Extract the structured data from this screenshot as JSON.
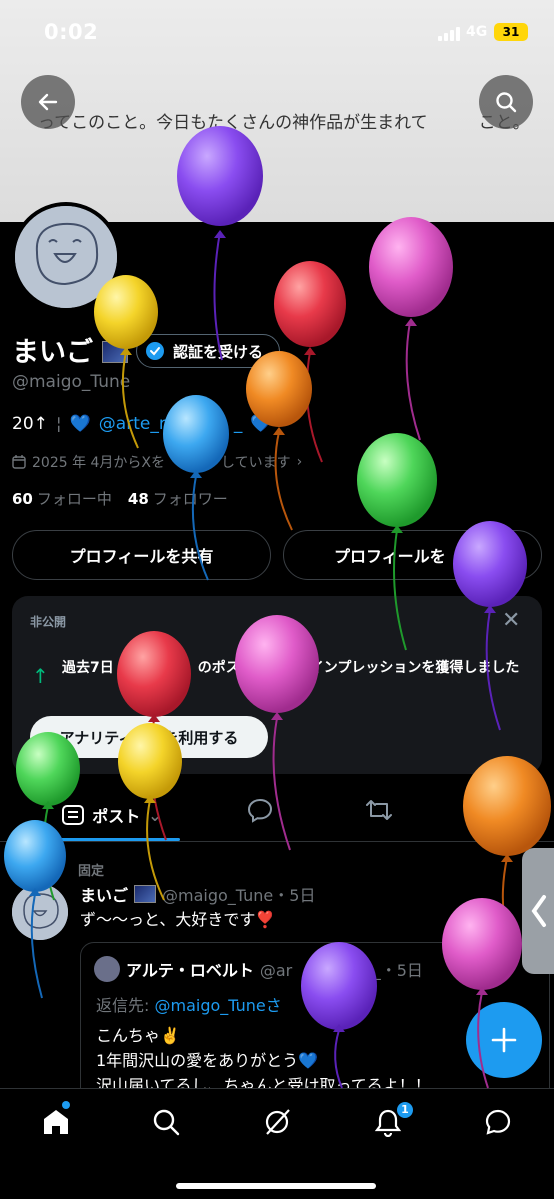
{
  "status_bar": {
    "time": "0:02",
    "network": "4G",
    "battery": "31"
  },
  "banner": {
    "text": "ってこのこと。今日もたくさんの神作品が生まれて　　　こと。"
  },
  "profile": {
    "display_name": "まいご",
    "verify_label": "認証を受ける",
    "handle": "@maigo_Tune",
    "bio_prefix": "20↑",
    "bio_link": "@arte_r",
    "bio_link_tail": "_",
    "joined": "2025 年 4月からXを　　　　しています",
    "following_count": "60",
    "following_label": "フォロー中",
    "followers_count": "48",
    "followers_label": "フォロワー",
    "share_button": "プロフィールを共有",
    "second_button": "プロフィールを"
  },
  "analytics": {
    "private_label": "非公開",
    "text": "過去7日　　　　　　のポス　　　件のインプレッションを獲得しました",
    "button": "アナリティ　　を利用する"
  },
  "tabs": {
    "posts": "ポスト"
  },
  "pinned_post": {
    "pinned_label": "固定",
    "author": "まいご",
    "meta": "@maigo_Tune・5日",
    "text": "ず〜〜っと、大好きです❣️",
    "quote": {
      "author": "アルテ・ロベルト",
      "meta": "@ar　　　erto_・5日",
      "reply_prefix": "返信先: ",
      "reply_handle": "@maigo_Tuneさ",
      "line1": "こんちゃ✌️",
      "line2": "1年間沢山の愛をありがとう💙",
      "line3": "沢山届いてるし、ちゃんと受け取ってるよ！！"
    }
  },
  "bottom_nav": {
    "notif_count": "1"
  },
  "colors": {
    "accent": "#1d9bf0",
    "background": "#000000",
    "muted": "#71767b"
  }
}
